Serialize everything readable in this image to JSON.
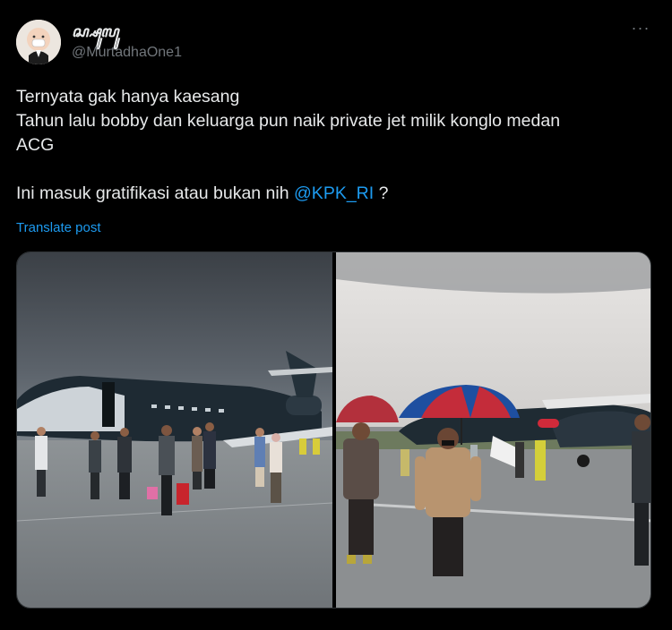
{
  "author": {
    "display_name": "ꦱ꧀ꦱꦸꦭꦸ",
    "handle": "@MurtadhaOne1",
    "avatar_icon": "baby-boss-avatar"
  },
  "more_label": "···",
  "tweet": {
    "line1": "Ternyata gak hanya kaesang",
    "line2": "Tahun lalu bobby dan keluarga pun naik private jet milik konglo medan",
    "line3": "ACG",
    "line4_prefix": "Ini masuk gratifikasi atau bukan nih ",
    "mention": "@KPK_RI",
    "line4_suffix": " ?"
  },
  "translate_label": "Translate post",
  "colors": {
    "accent": "#1d9bf0",
    "background": "#000000",
    "text": "#e7e9ea",
    "secondary": "#71767b"
  },
  "media": {
    "left_photo": "private-jet-boarding-photo",
    "right_photo": "umbrella-walk-photo"
  }
}
